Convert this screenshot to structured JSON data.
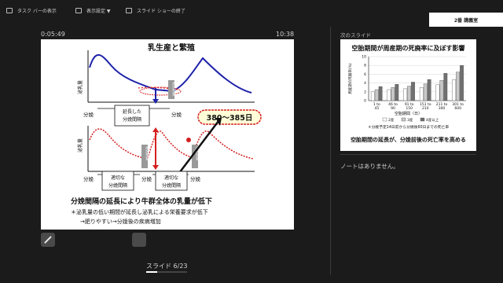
{
  "toolbar": {
    "taskbar_label": "タスク バーの表示",
    "display_settings_label": "表示設定 ▼",
    "end_show_label": "スライド ショーの終了",
    "role_badge": "2番 講義室"
  },
  "timer": {
    "elapsed": "0:05:49",
    "clock": "10:38"
  },
  "current_slide": {
    "title": "乳生産と繁殖",
    "ylabel_top": "泌乳量",
    "ylabel_bottom": "泌乳量",
    "calving": "分娩",
    "dry_period": "乾乳期間",
    "extended_label": "延長した",
    "extended_label2": "分娩間隔",
    "proper_label": "適切な",
    "proper_label2": "分娩間隔",
    "days_callout": "380～385日",
    "conclusion": "分娩間隔の延長により牛群全体の乳量が低下",
    "bullet1": "＊泌乳量の低い期間が延長し泌乳による栄養要求が低下",
    "bullet2": "→肥りやすい→分娩後の疾病増加"
  },
  "slide_counter": "スライド 6/23",
  "slide_progress": 0.26,
  "next_slide": {
    "header": "次のスライド",
    "title": "空胎期間が周産期の死廃率に及ぼす影響",
    "ylabel": "周産期の死廃率(%)",
    "xlabel": "空胎期間（日）",
    "legend": [
      "2産",
      "3産",
      "4産以上"
    ],
    "note": "＊分娩予定14日前から分娩後60日までの死亡率",
    "footer": "空胎期間の延長が、分娩前後の死亡率を高める"
  },
  "chart_data": {
    "type": "bar",
    "title": "空胎期間が周産期の死廃率に及ぼす影響",
    "xlabel": "空胎期間（日）",
    "ylabel": "周産期の死廃率(%)",
    "ylim": [
      0,
      10
    ],
    "ytick_labels": [
      "0",
      "2",
      "4",
      "6",
      "8",
      "10"
    ],
    "categories": [
      "1 to 45",
      "46 to 90",
      "91 to 150",
      "151 to 210",
      "211 to 300",
      "301 to 600"
    ],
    "series": [
      {
        "name": "2産",
        "values": [
          2.0,
          2.5,
          2.7,
          3.0,
          3.6,
          4.8
        ]
      },
      {
        "name": "3産",
        "values": [
          2.5,
          3.0,
          3.3,
          3.8,
          4.6,
          6.5
        ]
      },
      {
        "name": "4産以上",
        "values": [
          3.2,
          3.7,
          4.2,
          4.8,
          6.2,
          8.0
        ]
      }
    ],
    "colors": [
      "#ffffff",
      "#c8c8c8",
      "#707070"
    ],
    "legend_position": "bottom"
  },
  "notes": {
    "empty": "ノートはありません。"
  }
}
